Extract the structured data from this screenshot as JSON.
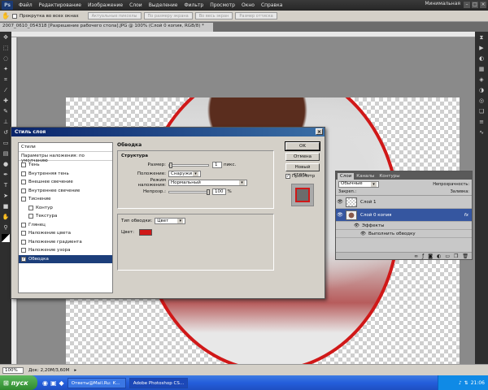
{
  "app": {
    "logo": "Ps",
    "menu": [
      "Файл",
      "Редактирование",
      "Изображение",
      "Слои",
      "Выделение",
      "Фильтр",
      "Просмотр",
      "Окно",
      "Справка"
    ],
    "workspace": "Минимальная"
  },
  "options_bar": {
    "checkbox_label": "Прокрутка во всех окнах",
    "buttons": [
      "Актуальные пикселы",
      "По размеру экрана",
      "Во весь экран",
      "Размер оттиска"
    ]
  },
  "document": {
    "tab_title": "2007_0610_054318 [Разрешение рабочего стола].JPG @ 100% (Слой 0 копия, RGB/8) *"
  },
  "status": {
    "zoom": "100%",
    "doc_info": "Док: 2,20M/3,60M"
  },
  "taskbar": {
    "start": "пуск",
    "items": [
      "Ответы@Mail.Ru: К...",
      "Adobe Photoshop CS..."
    ],
    "time": "21:06"
  },
  "dialog": {
    "title": "Стиль слоя",
    "style_list_header": "Стили",
    "blending_options": "Параметры наложения: по умолчанию",
    "styles": [
      {
        "label": "Тень",
        "checked": false
      },
      {
        "label": "Внутренняя тень",
        "checked": false
      },
      {
        "label": "Внешнее свечение",
        "checked": false
      },
      {
        "label": "Внутреннее свечение",
        "checked": false
      },
      {
        "label": "Тиснение",
        "checked": false
      },
      {
        "label": "Контур",
        "checked": false,
        "indent": true
      },
      {
        "label": "Текстура",
        "checked": false,
        "indent": true
      },
      {
        "label": "Глянец",
        "checked": false
      },
      {
        "label": "Наложение цвета",
        "checked": false
      },
      {
        "label": "Наложение градиента",
        "checked": false
      },
      {
        "label": "Наложение узора",
        "checked": false
      },
      {
        "label": "Обводка",
        "checked": true,
        "selected": true
      }
    ],
    "stroke": {
      "section": "Обводка",
      "structure": "Структура",
      "size_label": "Размер:",
      "size_value": "1",
      "size_unit": "пикс.",
      "position_label": "Положение:",
      "position_value": "Снаружи",
      "blend_label": "Режим наложения:",
      "blend_value": "Нормальный",
      "opacity_label": "Непрозр.:",
      "opacity_value": "100",
      "opacity_unit": "%",
      "fill_type_label": "Тип обводки:",
      "fill_type_value": "Цвет",
      "color_label": "Цвет:",
      "color": "#d01818"
    },
    "buttons": {
      "ok": "OK",
      "cancel": "Отмена",
      "new_style": "Новый стиль...",
      "preview": "Просмотр"
    }
  },
  "layers_panel": {
    "tabs": [
      "Слои",
      "Каналы",
      "Контуры"
    ],
    "blend_mode": "Обычные",
    "opacity_label": "Непрозрачность:",
    "lock_label": "Закреп.:",
    "fill_label": "Заливка:",
    "layers": [
      {
        "name": "Слой 1",
        "selected": false
      },
      {
        "name": "Слой 0 копия",
        "selected": true
      }
    ],
    "effects_label": "Эффекты",
    "effect_item": "Выполнить обводку"
  }
}
